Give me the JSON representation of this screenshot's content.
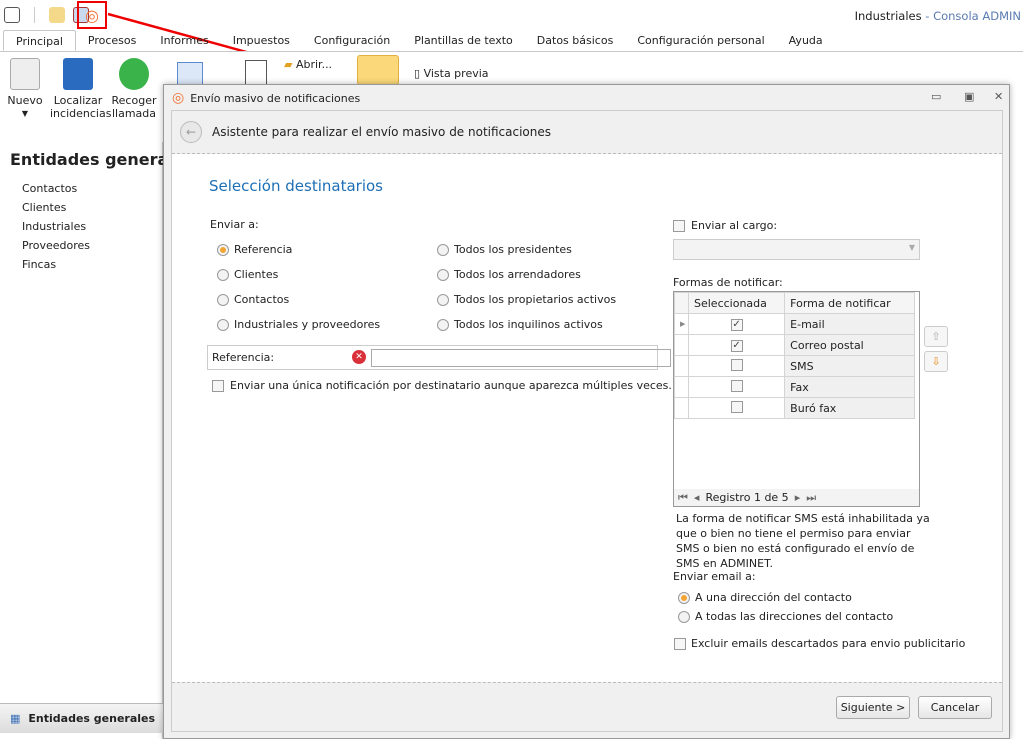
{
  "app": {
    "title_part1": "Industriales",
    "title_sep": " - ",
    "title_part2": "Consola ADMIN"
  },
  "tabs": [
    "Principal",
    "Procesos",
    "Informes",
    "Impuestos",
    "Configuración",
    "Plantillas de texto",
    "Datos básicos",
    "Configuración personal",
    "Ayuda"
  ],
  "ribbon": {
    "nuevo": "Nuevo",
    "localizar1": "Localizar",
    "localizar2": "incidencias",
    "recoger1": "Recoger",
    "recoger2": "llamada",
    "abrir": "Abrir...",
    "vista_previa": "Vista previa"
  },
  "left": {
    "title": "Entidades generales",
    "items": [
      "Contactos",
      "Clientes",
      "Industriales",
      "Proveedores",
      "Fincas"
    ],
    "bottom": "Entidades generales"
  },
  "dialog": {
    "title": "Envío masivo de notificaciones",
    "wizard": "Asistente para realizar el envío masivo de notificaciones",
    "section": "Selección destinatarios",
    "enviar_a": "Enviar a:",
    "options_left": [
      "Referencia",
      "Clientes",
      "Contactos",
      "Industriales y proveedores"
    ],
    "options_right": [
      "Todos los presidentes",
      "Todos los arrendadores",
      "Todos los propietarios activos",
      "Todos los inquilinos activos"
    ],
    "referencia_label": "Referencia:",
    "referencia_value": "",
    "unica": "Enviar una única notificación por destinatario aunque aparezca múltiples veces.",
    "enviar_cargo": "Enviar al cargo:",
    "formas": "Formas de notificar:",
    "grid_headers": [
      "Seleccionada",
      "Forma de notificar"
    ],
    "grid_rows": [
      {
        "name": "E-mail",
        "checked": true
      },
      {
        "name": "Correo postal",
        "checked": true
      },
      {
        "name": "SMS",
        "checked": false
      },
      {
        "name": "Fax",
        "checked": false
      },
      {
        "name": "Buró fax",
        "checked": false
      }
    ],
    "registro": "Registro 1 de 5",
    "sms_note": "La forma de notificar SMS está inhabilitada ya que o bien no tiene el permiso para enviar SMS o bien no está configurado el envío de SMS en ADMINET.",
    "email_label": "Enviar email a:",
    "email_opts": [
      "A una dirección del contacto",
      "A todas las direcciones del contacto"
    ],
    "excluir": "Excluir emails descartados para envio publicitario",
    "siguiente": "Siguiente >",
    "cancelar": "Cancelar"
  },
  "colors": {
    "accent": "#1e6fb5",
    "highlight": "#ee0000"
  }
}
